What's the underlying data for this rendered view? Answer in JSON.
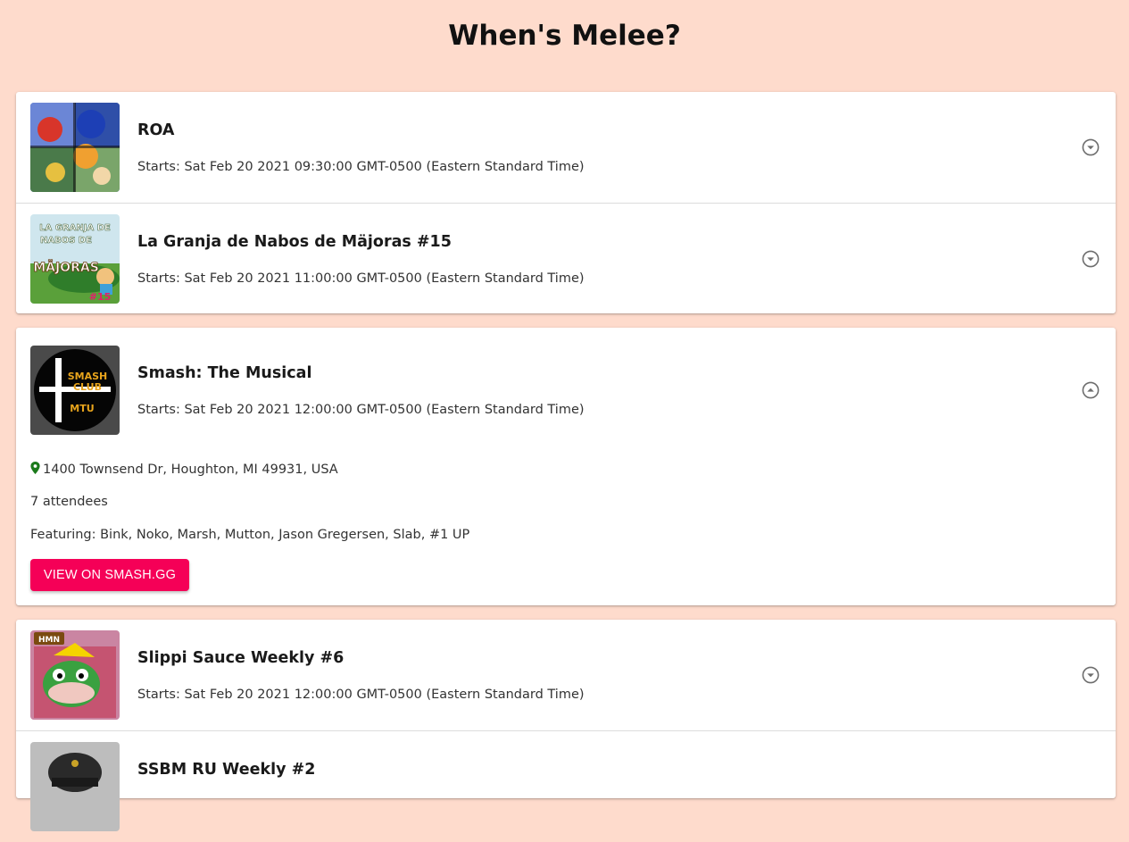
{
  "page": {
    "title": "When's Melee?"
  },
  "events": [
    {
      "name": "ROA",
      "starts": "Starts: Sat Feb 20 2021 09:30:00 GMT-0500 (Eastern Standard Time)",
      "expanded": false
    },
    {
      "name": "La Granja de Nabos de Mäjoras #15",
      "starts": "Starts: Sat Feb 20 2021 11:00:00 GMT-0500 (Eastern Standard Time)",
      "expanded": false,
      "thumb_text": [
        "LA GRANJA DE",
        "NABOS DE",
        "MÄJORAS",
        "#15"
      ]
    },
    {
      "name": "Smash: The Musical",
      "starts": "Starts: Sat Feb 20 2021 12:00:00 GMT-0500 (Eastern Standard Time)",
      "expanded": true,
      "thumb_text": [
        "SMASH",
        "CLUB",
        "MTU"
      ],
      "address": "1400 Townsend Dr, Houghton, MI 49931, USA",
      "attendees": "7 attendees",
      "featuring": "Featuring: Bink, Noko, Marsh, Mutton, Jason Gregersen, Slab, #1 UP",
      "button_label": "VIEW ON SMASH.GG"
    },
    {
      "name": "Slippi Sauce Weekly #6",
      "starts": "Starts: Sat Feb 20 2021 12:00:00 GMT-0500 (Eastern Standard Time)",
      "expanded": false,
      "thumb_text": [
        "HMN"
      ]
    },
    {
      "name": "SSBM RU Weekly #2",
      "expanded": false
    }
  ],
  "icons": {
    "expand": "chevron-down-circle-icon",
    "collapse": "chevron-up-circle-icon",
    "location": "map-pin-icon"
  },
  "colors": {
    "background": "#fedbcc",
    "accent_button": "#f50057",
    "location_pin": "#1b7a1b",
    "icon_gray": "#6d6d6d"
  }
}
